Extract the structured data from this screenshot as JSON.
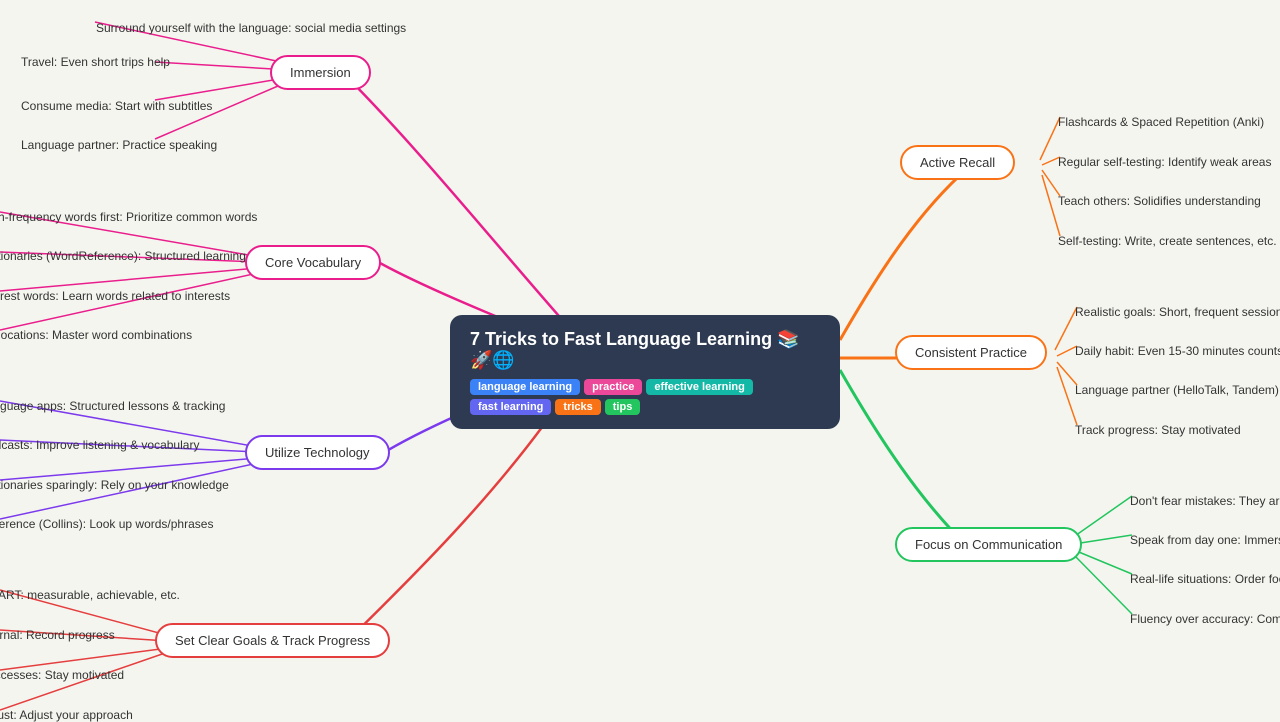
{
  "center": {
    "title": "7 Tricks to Fast Language Learning 📚🚀🌐",
    "tags": [
      {
        "label": "language learning",
        "class": "tag-blue"
      },
      {
        "label": "practice",
        "class": "tag-pink"
      },
      {
        "label": "effective learning",
        "class": "tag-teal"
      },
      {
        "label": "fast learning",
        "class": "tag-indigo"
      },
      {
        "label": "tricks",
        "class": "tag-orange"
      },
      {
        "label": "tips",
        "class": "tag-green"
      }
    ]
  },
  "nodes": {
    "immersion": "Immersion",
    "core_vocabulary": "Core Vocabulary",
    "utilize_technology": "Utilize Technology",
    "set_clear_goals": "Set Clear Goals & Track Progress",
    "active_recall": "Active Recall",
    "consistent_practice": "Consistent Practice",
    "focus_communication": "Focus on Communication"
  },
  "leaves": {
    "immersion": [
      "Surround yourself with the language: social media settings",
      "Travel: Even short trips help",
      "Consume media: Start with subtitles",
      "Language partner: Practice speaking"
    ],
    "core_vocabulary": [
      "High-frequency words first: Prioritize common words",
      "Dictionaries (WordReference): Structured learning",
      "Interest words: Learn words related to interests",
      "Collocations: Master word combinations"
    ],
    "utilize_technology": [
      "Language apps: Structured lessons & tracking",
      "Podcasts: Improve listening & vocabulary",
      "Dictionaries sparingly: Rely on your knowledge",
      "Reference (Collins): Look up words/phrases"
    ],
    "goals": [
      "SMART: measurable, achievable, etc.",
      "Journal: Record progress",
      "Successes: Stay motivated",
      "Adjust: Adjust your approach"
    ],
    "active_recall": [
      "Flashcards & Spaced Repetition (Anki)",
      "Regular self-testing: Identify weak areas",
      "Teach others: Solidifies understanding",
      "Self-testing: Write, create sentences, etc."
    ],
    "consistent_practice": [
      "Realistic goals: Short, frequent sessions",
      "Daily habit: Even 15-30 minutes counts",
      "Language partner (HelloTalk, Tandem)",
      "Track progress: Stay motivated"
    ],
    "focus_communication": [
      "Don't fear mistakes: They are part of learning",
      "Speak from day one: Immerse yourself",
      "Real-life situations: Order food, ask directions",
      "Fluency over accuracy: Communication first"
    ]
  },
  "colors": {
    "immersion": "#e91e8c",
    "core_vocabulary": "#e91e8c",
    "utilize_technology": "#7c3aed",
    "goals": "#e53e3e",
    "active_recall": "#f97316",
    "consistent_practice": "#f97316",
    "focus_communication": "#22c55e",
    "center_bg": "#2d3a52"
  }
}
